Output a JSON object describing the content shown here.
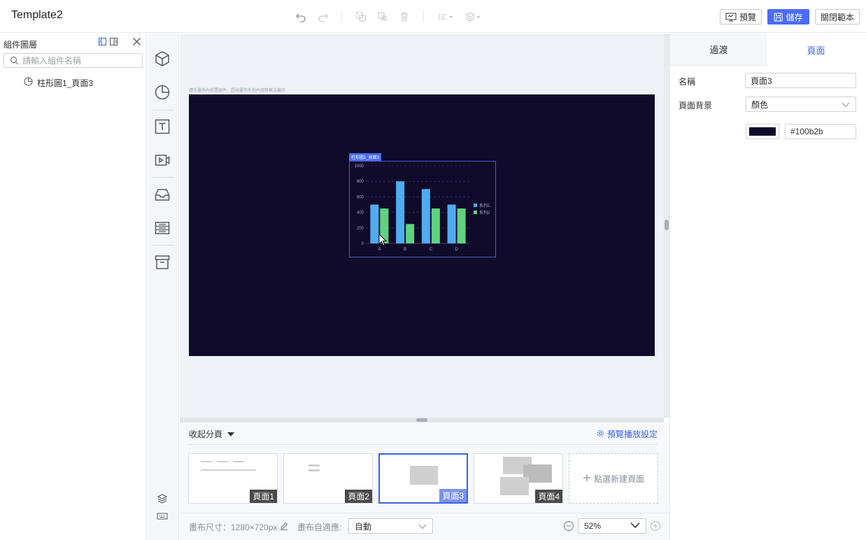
{
  "app": {
    "title": "Template2"
  },
  "toolbar": {
    "preview_label": "預覽",
    "save_label": "儲存",
    "close_label": "關閉範本"
  },
  "layers_panel": {
    "title": "組件圖層",
    "search_placeholder": "請輸入組件名稱",
    "items": [
      {
        "label": "柱形圖1_頁面3"
      }
    ]
  },
  "component_bar": {
    "icons": [
      "cube-icon",
      "pie-chart-icon",
      "text-icon",
      "video-icon",
      "inbox-icon",
      "list-icon",
      "archive-icon"
    ],
    "bottom_icons": [
      "layers-icon",
      "keyboard-icon"
    ]
  },
  "canvas": {
    "hint": "請在畫布內放置組件，超出畫布外的內容將無法顯示",
    "background": "#100b2b",
    "chart_tag": "柱形圖1_頁面3"
  },
  "chart_data": {
    "type": "bar",
    "categories": [
      "A",
      "B",
      "C",
      "D"
    ],
    "series": [
      {
        "name": "系列1",
        "values": [
          500,
          800,
          700,
          500
        ],
        "color": "#4facf0"
      },
      {
        "name": "系列2",
        "values": [
          450,
          250,
          450,
          450
        ],
        "color": "#5fd27f"
      }
    ],
    "yticks": [
      "0",
      "200",
      "400",
      "600",
      "800",
      "1000"
    ],
    "ylim": [
      0,
      1000
    ],
    "legend": "right",
    "grid": true
  },
  "pages": {
    "collapse_label": "收起分頁",
    "preview_settings_label": "預覽播放設定",
    "items": [
      {
        "label": "頁面1",
        "active": false
      },
      {
        "label": "頁面2",
        "active": false
      },
      {
        "label": "頁面3",
        "active": true
      },
      {
        "label": "頁面4",
        "active": false
      }
    ],
    "add_label": "點選新建頁面"
  },
  "bottom": {
    "canvas_size_label": "畫布尺寸：1280×720px",
    "adapt_label": "畫布自適應:",
    "adapt_value": "自動",
    "zoom_value": "52%"
  },
  "props": {
    "tabs": [
      "過渡",
      "頁面"
    ],
    "active_tab": "頁面",
    "name_label": "名稱",
    "name_value": "頁面3",
    "bg_label": "頁面背景",
    "bg_type": "顏色",
    "bg_color": "#100b2b"
  }
}
